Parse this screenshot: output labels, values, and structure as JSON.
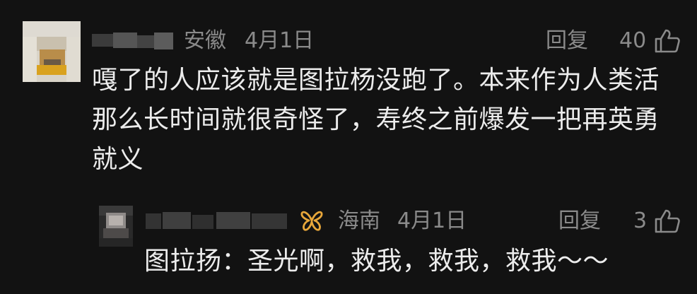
{
  "comments": [
    {
      "location": "安徽",
      "date": "4月1日",
      "reply_label": "回复",
      "like_count": "40",
      "text_lines": [
        "嘎了的人应该就是图拉杨没跑了。本来作为人类活",
        "那么长时间就很奇怪了，寿终之前爆发一把再英勇",
        "就义"
      ]
    },
    {
      "location": "海南",
      "date": "4月1日",
      "reply_label": "回复",
      "like_count": "3",
      "text": "图拉扬：圣光啊，救我，救我，救我～～"
    }
  ],
  "colors": {
    "background": "#121212",
    "primary_text": "#ececec",
    "meta_text": "#8a8a8a",
    "badge": "#e8a73a"
  },
  "icons": {
    "like": "thumbs-up-outline-icon",
    "badge": "butterfly-badge-icon"
  }
}
